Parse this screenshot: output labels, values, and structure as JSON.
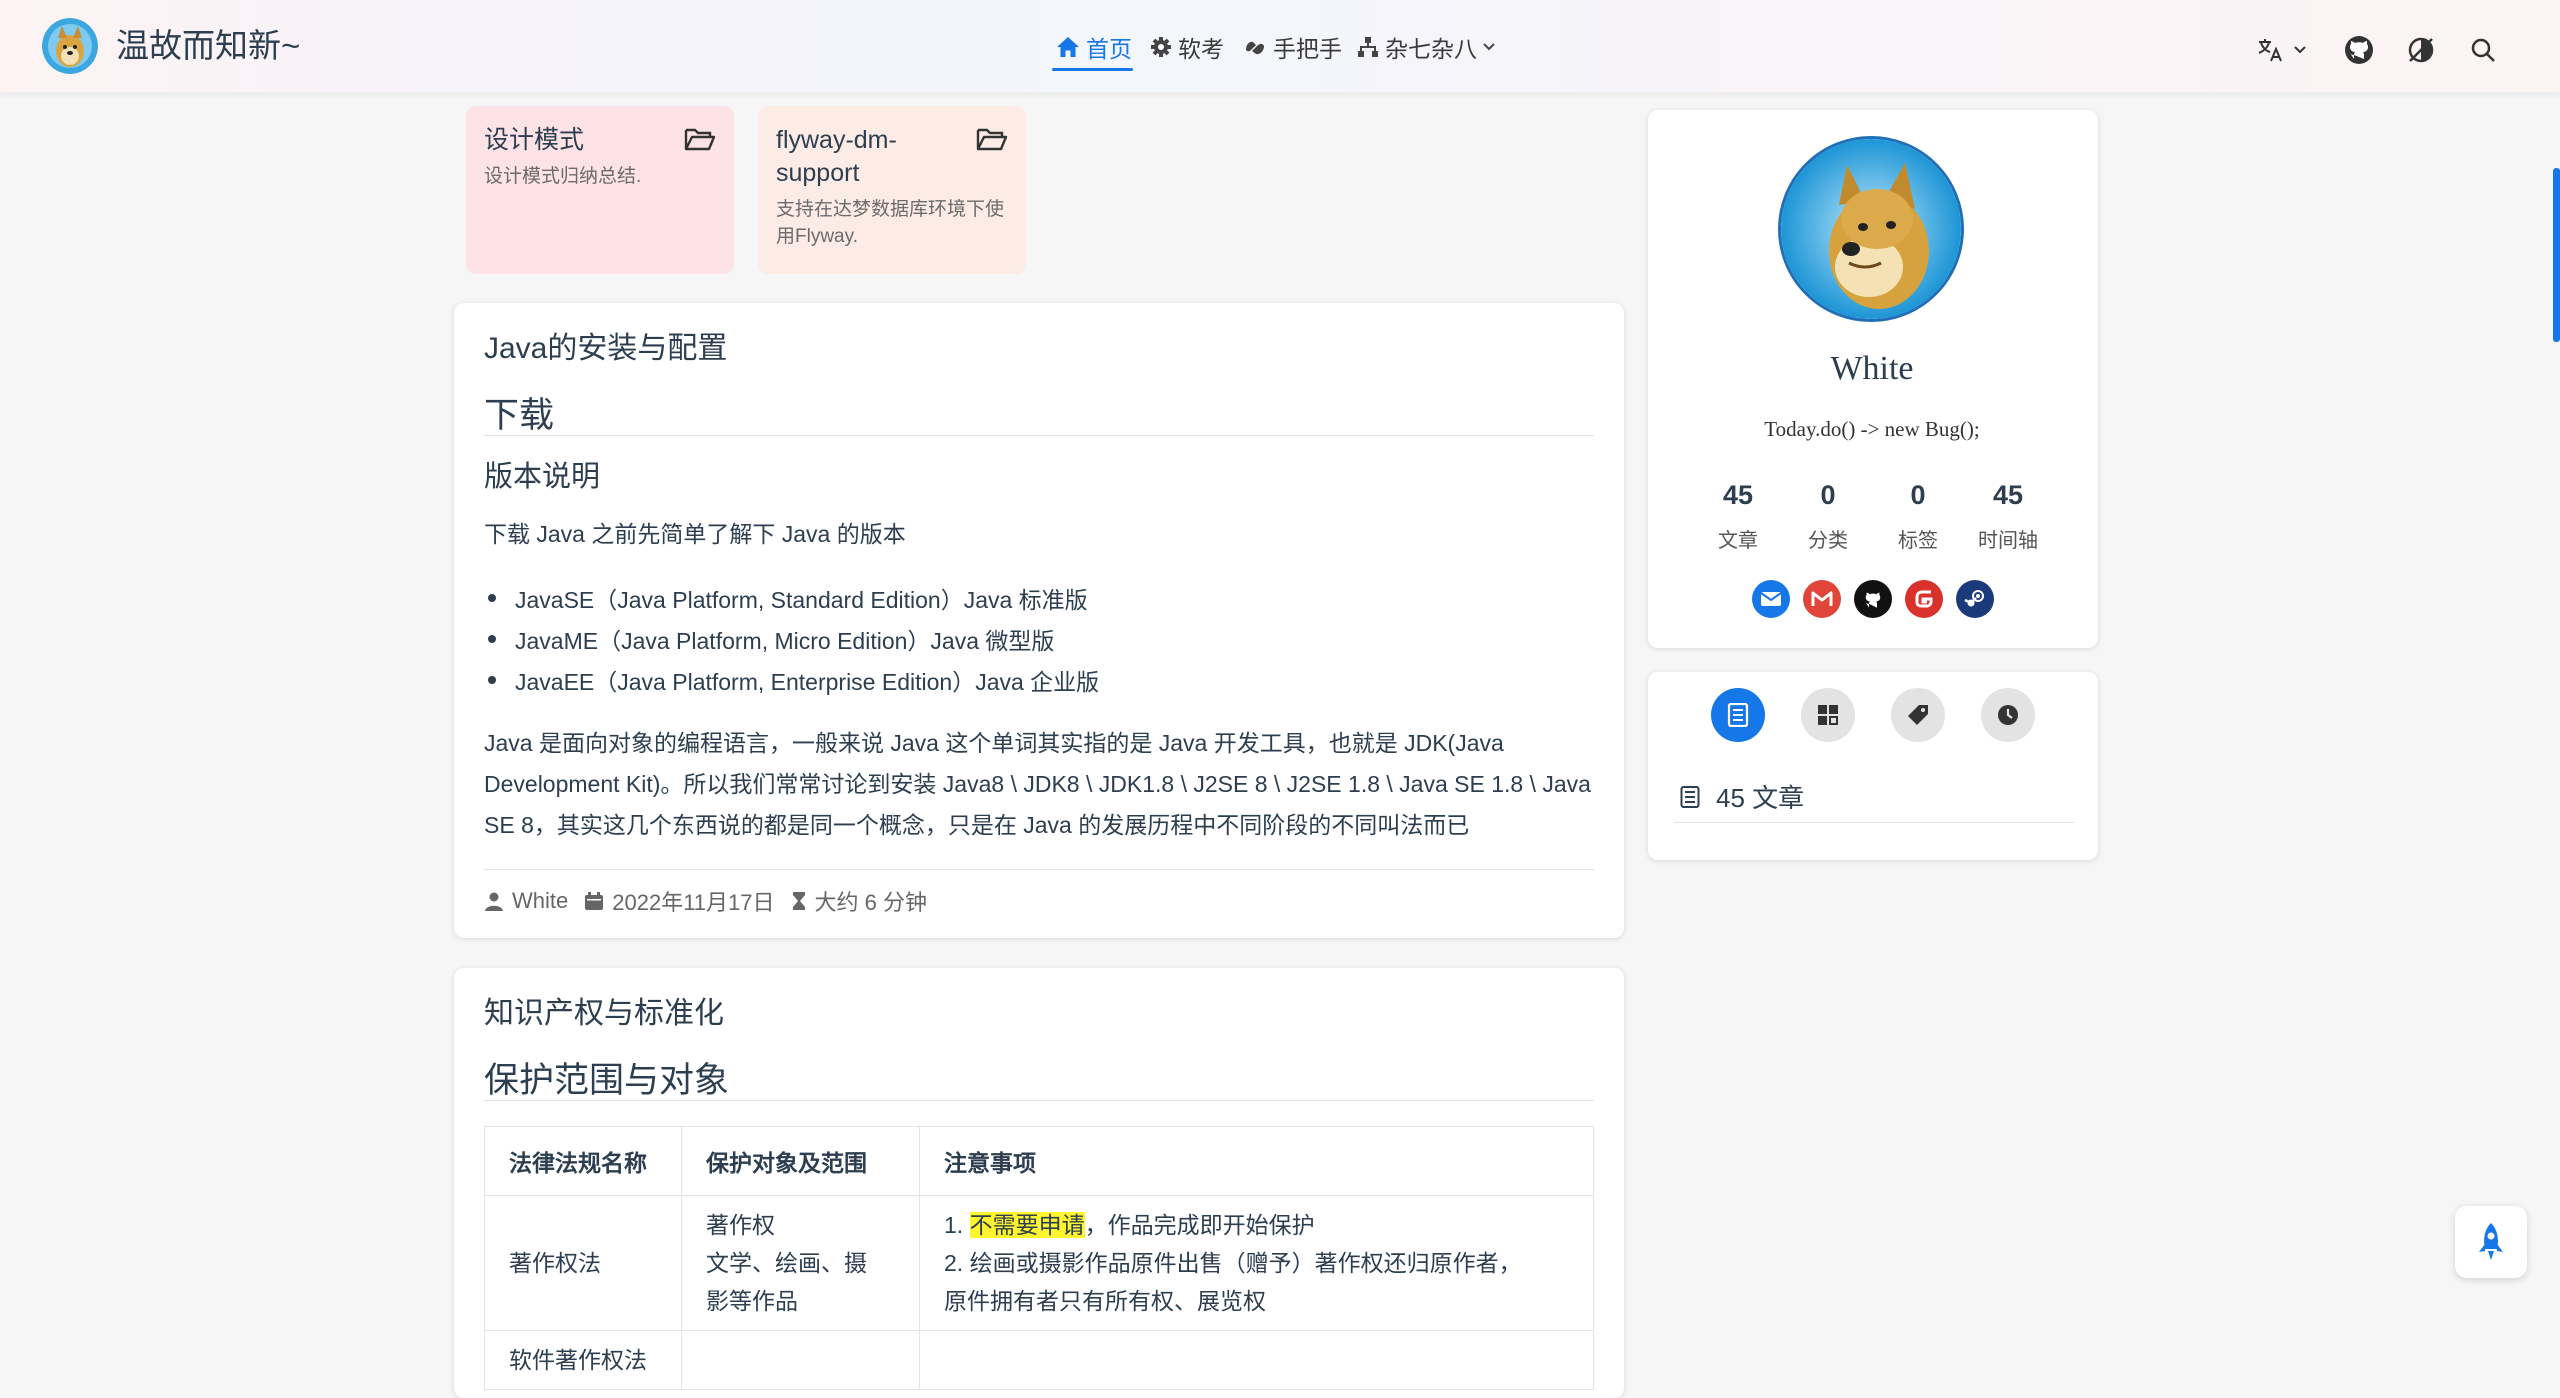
{
  "site": {
    "title": "温故而知新~"
  },
  "nav": {
    "items": [
      {
        "label": "首页",
        "icon": "home-icon",
        "active": true
      },
      {
        "label": "软考",
        "icon": "gear-icon",
        "active": false
      },
      {
        "label": "手把手",
        "icon": "hands-icon",
        "active": false
      },
      {
        "label": "杂七杂八",
        "icon": "sitemap-icon",
        "active": false,
        "dropdown": true
      }
    ],
    "right_icons": [
      "translate-icon",
      "github-icon",
      "theme-toggle-icon",
      "search-icon"
    ]
  },
  "projects": [
    {
      "title": "设计模式",
      "description": "设计模式归纳总结.",
      "color": "#fde3e6"
    },
    {
      "title": "flyway-dm-support",
      "description": "支持在达梦数据库环境下使用Flyway.",
      "color": "#fdece6"
    }
  ],
  "article1": {
    "title": "Java的安装与配置",
    "h2": "下载",
    "h3": "版本说明",
    "intro": "下载 Java 之前先简单了解下 Java 的版本",
    "list": [
      "JavaSE（Java Platform, Standard Edition）Java 标准版",
      "JavaME（Java Platform, Micro Edition）Java 微型版",
      "JavaEE（Java Platform, Enterprise Edition）Java 企业版"
    ],
    "paragraph_lines": [
      "Java 是面向对象的编程语言，一般来说 Java 这个单词其实指的是 Java 开发工具，也就是 JDK(Java",
      "Development Kit)。所以我们常常讨论到安装 Java8 \\ JDK8 \\ JDK1.8 \\ J2SE 8 \\ J2SE 1.8 \\ Java SE 1.8 \\ Java",
      "SE 8，其实这几个东西说的都是同一个概念，只是在 Java 的发展历程中不同阶段的不同叫法而已"
    ],
    "meta": {
      "author": "White",
      "date": "2022年11月17日",
      "read_time": "大约 6 分钟"
    }
  },
  "article2": {
    "title": "知识产权与标准化",
    "h2": "保护范围与对象",
    "table": {
      "headers": [
        "法律法规名称",
        "保护对象及范围",
        "注意事项"
      ],
      "row1": {
        "law": "著作权法",
        "scope_lines": [
          "著作权",
          "文学、绘画、摄",
          "影等作品"
        ],
        "note1_prefix": "1. ",
        "note1_highlight": "不需要申请",
        "note1_rest": "，作品完成即开始保护",
        "note2_line1": "2. 绘画或摄影作品原件出售（赠予）著作权还归原作者，",
        "note2_line2": "原件拥有者只有所有权、展览权"
      },
      "row2": {
        "law": "软件著作权法"
      }
    }
  },
  "profile": {
    "name": "White",
    "motto": "Today.do() -> new Bug();",
    "stats": [
      {
        "num": "45",
        "label": "文章"
      },
      {
        "num": "0",
        "label": "分类"
      },
      {
        "num": "0",
        "label": "标签"
      },
      {
        "num": "45",
        "label": "时间轴"
      }
    ],
    "socials": [
      {
        "name": "email-icon",
        "color": "#1677e8"
      },
      {
        "name": "gmail-icon",
        "color": "#e0453a"
      },
      {
        "name": "github-icon",
        "color": "#111111"
      },
      {
        "name": "gitee-icon",
        "color": "#d9312c"
      },
      {
        "name": "steam-icon",
        "color": "#1b3a7a"
      }
    ]
  },
  "info_panel": {
    "tabs": [
      "article-list-icon",
      "category-icon",
      "tag-icon",
      "clock-icon"
    ],
    "active_tab": 0,
    "count_text": "45 文章"
  },
  "colors": {
    "accent": "#1677e8",
    "text": "#2c3e50",
    "highlight": "#fff52e"
  }
}
